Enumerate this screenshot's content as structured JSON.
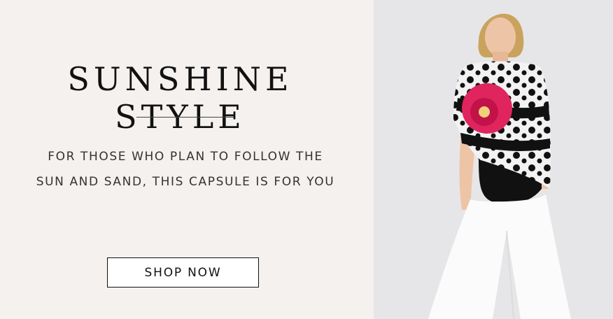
{
  "banner": {
    "title": "SUNSHINE STYLE",
    "subtitle_line1": "FOR THOSE WHO PLAN TO FOLLOW THE",
    "subtitle_line2": "SUN AND SAND, THIS CAPSULE IS FOR YOU",
    "cta_label": "SHOP NOW"
  },
  "colors": {
    "left_panel_bg": "#f4f1ef",
    "right_panel_bg": "#e6e6e8",
    "text": "#111111",
    "accent_flower": "#e0245e"
  },
  "image": {
    "subject": "model-photo"
  }
}
